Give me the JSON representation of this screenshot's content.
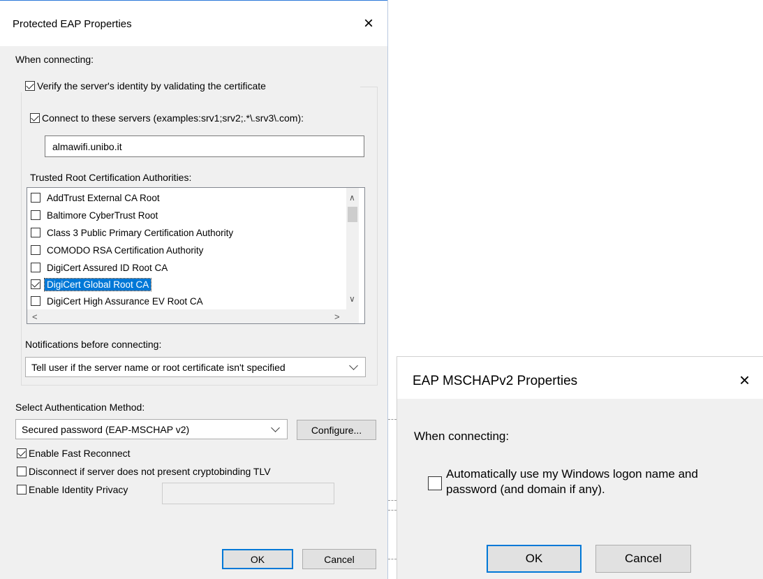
{
  "peap": {
    "title": "Protected EAP Properties",
    "when_connecting": "When connecting:",
    "verify_identity": {
      "label": "Verify the server's identity by validating the certificate",
      "checked": true
    },
    "connect_servers": {
      "label": "Connect to these servers (examples:srv1;srv2;.*\\.srv3\\.com):",
      "checked": true
    },
    "servers_value": "almawifi.unibo.it",
    "trusted_root_label": "Trusted Root Certification Authorities:",
    "certificates": [
      {
        "name": "AddTrust External CA Root",
        "checked": false,
        "selected": false
      },
      {
        "name": "Baltimore CyberTrust Root",
        "checked": false,
        "selected": false
      },
      {
        "name": "Class 3 Public Primary Certification Authority",
        "checked": false,
        "selected": false
      },
      {
        "name": "COMODO RSA Certification Authority",
        "checked": false,
        "selected": false
      },
      {
        "name": "DigiCert Assured ID Root CA",
        "checked": false,
        "selected": false
      },
      {
        "name": "DigiCert Global Root CA",
        "checked": true,
        "selected": true
      },
      {
        "name": "DigiCert High Assurance EV Root CA",
        "checked": false,
        "selected": false
      }
    ],
    "notifications_label": "Notifications before connecting:",
    "notifications_value": "Tell user if the server name or root certificate isn't specified",
    "auth_method_label": "Select Authentication Method:",
    "auth_method_value": "Secured password (EAP-MSCHAP v2)",
    "configure_label": "Configure...",
    "fast_reconnect": {
      "label": "Enable Fast Reconnect",
      "checked": true
    },
    "cryptobinding": {
      "label": "Disconnect if server does not present cryptobinding TLV",
      "checked": false
    },
    "identity_privacy": {
      "label": "Enable Identity Privacy",
      "checked": false
    },
    "identity_privacy_value": "",
    "ok_label": "OK",
    "cancel_label": "Cancel"
  },
  "mschap": {
    "title": "EAP MSCHAPv2 Properties",
    "when_connecting": "When connecting:",
    "auto_logon_line1": "Automatically use my Windows logon name and",
    "auto_logon_line2": "password (and domain if any).",
    "auto_logon_checked": false,
    "ok_label": "OK",
    "cancel_label": "Cancel"
  },
  "icons": {
    "close": "×",
    "scroll_up": "∧",
    "scroll_down": "∨",
    "scroll_left": "<",
    "scroll_right": ">"
  },
  "colors": {
    "accent": "#0078d7",
    "selection": "#0078d7",
    "dialog_bg": "#f0f0f0"
  }
}
